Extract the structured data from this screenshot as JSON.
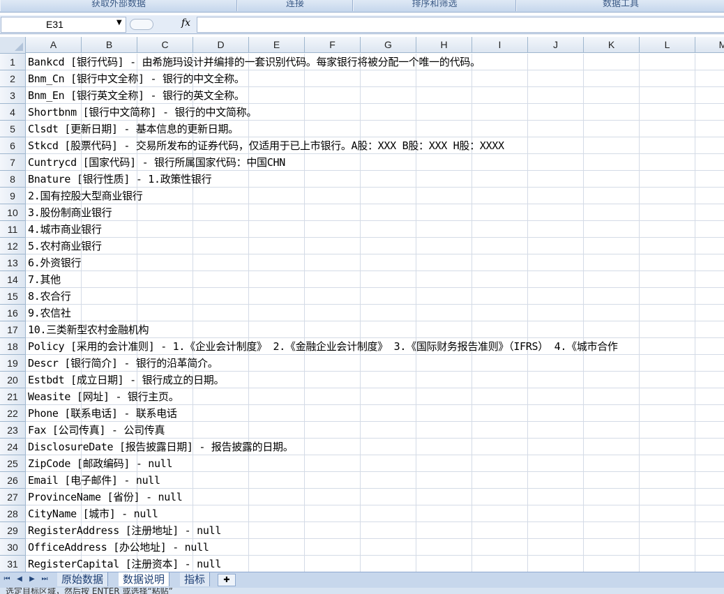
{
  "ribbon": {
    "groups": [
      "获取外部数据",
      "连接",
      "排序和筛选",
      "数据工具"
    ]
  },
  "formula_bar": {
    "name_box": "E31",
    "fx": "fx",
    "formula": ""
  },
  "grid": {
    "columns": [
      "A",
      "B",
      "C",
      "D",
      "E",
      "F",
      "G",
      "H",
      "I",
      "J",
      "K",
      "L",
      "M"
    ],
    "rows": [
      {
        "num": "1",
        "a": "Bankcd [银行代码] - 由希施玛设计并编排的一套识别代码。每家银行将被分配一个唯一的代码。"
      },
      {
        "num": "2",
        "a": "Bnm_Cn [银行中文全称] - 银行的中文全称。"
      },
      {
        "num": "3",
        "a": "Bnm_En [银行英文全称] - 银行的英文全称。"
      },
      {
        "num": "4",
        "a": "Shortbnm [银行中文简称] - 银行的中文简称。"
      },
      {
        "num": "5",
        "a": "Clsdt [更新日期] - 基本信息的更新日期。"
      },
      {
        "num": "6",
        "a": "Stkcd [股票代码] - 交易所发布的证券代码，仅适用于已上市银行。A股：XXX B股：XXX H股：XXXX"
      },
      {
        "num": "7",
        "a": "Cuntrycd [国家代码] - 银行所属国家代码：中国CHN"
      },
      {
        "num": "8",
        "a": "Bnature [银行性质] - 1.政策性银行"
      },
      {
        "num": "9",
        "a": "2.国有控股大型商业银行"
      },
      {
        "num": "10",
        "a": "3.股份制商业银行"
      },
      {
        "num": "11",
        "a": "4.城市商业银行"
      },
      {
        "num": "12",
        "a": "5.农村商业银行"
      },
      {
        "num": "13",
        "a": "6.外资银行"
      },
      {
        "num": "14",
        "a": "7.其他"
      },
      {
        "num": "15",
        "a": "8.农合行"
      },
      {
        "num": "16",
        "a": "9.农信社"
      },
      {
        "num": "17",
        "a": "10.三类新型农村金融机构"
      },
      {
        "num": "18",
        "a": "Policy [采用的会计准则] - 1.《企业会计制度》 2.《金融企业会计制度》 3.《国际财务报告准则》（IFRS） 4.《城市合作"
      },
      {
        "num": "19",
        "a": "Descr [银行简介] - 银行的沿革简介。"
      },
      {
        "num": "20",
        "a": "Estbdt [成立日期] - 银行成立的日期。"
      },
      {
        "num": "21",
        "a": "Weasite [网址] - 银行主页。"
      },
      {
        "num": "22",
        "a": "Phone [联系电话] - 联系电话"
      },
      {
        "num": "23",
        "a": "Fax [公司传真] - 公司传真"
      },
      {
        "num": "24",
        "a": "DisclosureDate [报告披露日期] - 报告披露的日期。"
      },
      {
        "num": "25",
        "a": "ZipCode [邮政编码] - null"
      },
      {
        "num": "26",
        "a": "Email [电子邮件] - null"
      },
      {
        "num": "27",
        "a": "ProvinceName [省份] - null"
      },
      {
        "num": "28",
        "a": "CityName [城市] - null"
      },
      {
        "num": "29",
        "a": "RegisterAddress [注册地址] - null"
      },
      {
        "num": "30",
        "a": "OfficeAddress [办公地址] - null"
      },
      {
        "num": "31",
        "a": "RegisterCapital [注册资本] - null"
      }
    ]
  },
  "sheets": {
    "tabs": [
      "原始数据",
      "数据说明",
      "指标"
    ],
    "active": "数据说明"
  },
  "status_bar": {
    "text": "选定目标区域，然后按 ENTER 或选择“粘贴”"
  }
}
